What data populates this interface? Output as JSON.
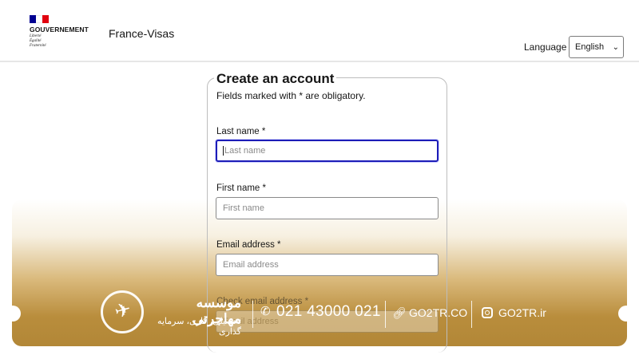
{
  "header": {
    "gov_title": "GOUVERNEMENT",
    "motto": [
      "Liberté",
      "Égalité",
      "Fraternité"
    ],
    "site_name": "France-Visas",
    "language_label": "Language :",
    "language_selected": "English"
  },
  "form": {
    "title": "Create an account",
    "note": "Fields marked with * are obligatory.",
    "fields": [
      {
        "label": "Last name *",
        "placeholder": "Last name"
      },
      {
        "label": "First name *",
        "placeholder": "First name"
      },
      {
        "label": "Email address *",
        "placeholder": "Email address"
      },
      {
        "label": "Check email address *",
        "placeholder": "Email address"
      }
    ]
  },
  "watermark": {
    "title": "موسسه مهاجرتی",
    "subtitle": "تحصیلی، کاری، سرمایه گذاری",
    "phone": "021 43000 021",
    "website": "GO2TR.CO",
    "instagram": "GO2TR.ir"
  },
  "colors": {
    "focus_border": "#1d1db8",
    "banner_gold": "#b28737",
    "flag_blue": "#000091",
    "flag_red": "#e1000f"
  }
}
